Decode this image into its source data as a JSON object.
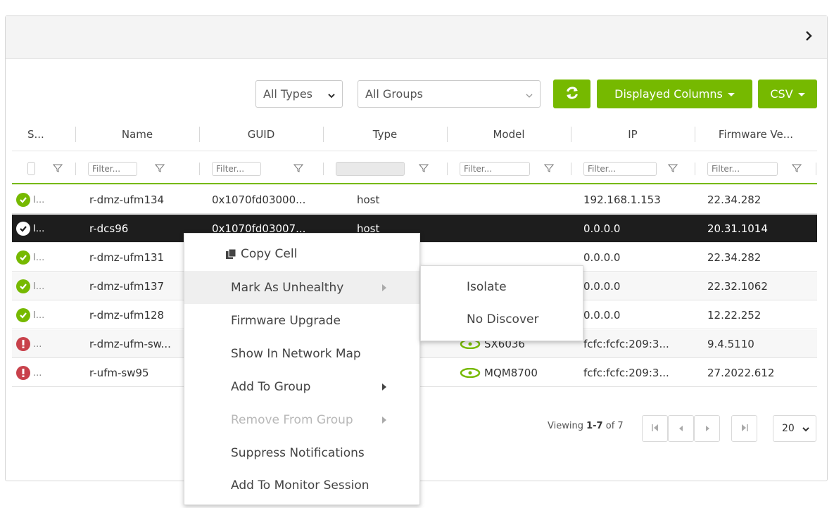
{
  "toolbar": {
    "type_filter": "All Types",
    "group_filter": "All Groups",
    "displayed_columns_label": "Displayed Columns",
    "csv_label": "CSV"
  },
  "columns": [
    "S...",
    "Name",
    "GUID",
    "Type",
    "Model",
    "IP",
    "Firmware Ve..."
  ],
  "filter_placeholder": "Filter...",
  "rows": [
    {
      "status": "ok",
      "status_text": "I...",
      "name": "r-dmz-ufm134",
      "guid": "0x1070fd03000...",
      "type": "host",
      "model": "",
      "ip": "192.168.1.153",
      "firmware": "22.34.282"
    },
    {
      "status": "ok",
      "status_text": "I...",
      "name": "r-dcs96",
      "guid": "0x1070fd03007...",
      "type": "host",
      "model": "",
      "ip": "0.0.0.0",
      "firmware": "20.31.1014"
    },
    {
      "status": "ok",
      "status_text": "I...",
      "name": "r-dmz-ufm131",
      "guid": "",
      "type": "",
      "model": "",
      "ip": "0.0.0.0",
      "firmware": "22.34.282"
    },
    {
      "status": "ok",
      "status_text": "I...",
      "name": "r-dmz-ufm137",
      "guid": "",
      "type": "",
      "model": "",
      "ip": "0.0.0.0",
      "firmware": "22.32.1062"
    },
    {
      "status": "ok",
      "status_text": "I...",
      "name": "r-dmz-ufm128",
      "guid": "",
      "type": "",
      "model": "",
      "ip": "0.0.0.0",
      "firmware": "12.22.252"
    },
    {
      "status": "error",
      "status_text": "...",
      "name": "r-dmz-ufm-sw...",
      "guid": "",
      "type": "",
      "model": "SX6036",
      "ip": "fcfc:fcfc:209:3...",
      "firmware": "9.4.5110"
    },
    {
      "status": "error",
      "status_text": "...",
      "name": "r-ufm-sw95",
      "guid": "",
      "type": "",
      "model": "MQM8700",
      "ip": "fcfc:fcfc:209:3...",
      "firmware": "27.2022.612"
    }
  ],
  "pagination": {
    "viewing_prefix": "Viewing",
    "range": "1-7",
    "of_label": "of",
    "total": "7",
    "page_size": "20"
  },
  "context_menu": {
    "items": [
      {
        "label": "Copy Cell"
      },
      {
        "label": "Mark As Unhealthy"
      },
      {
        "label": "Firmware Upgrade"
      },
      {
        "label": "Show In Network Map"
      },
      {
        "label": "Add To Group"
      },
      {
        "label": "Remove From Group"
      },
      {
        "label": "Suppress Notifications"
      },
      {
        "label": "Add To Monitor Session"
      }
    ],
    "submenu": [
      "Isolate",
      "No Discover"
    ]
  },
  "colors": {
    "accent": "#76b900",
    "ok": "#76b900",
    "error": "#c8414b",
    "selected_row": "#1d1d1d"
  }
}
